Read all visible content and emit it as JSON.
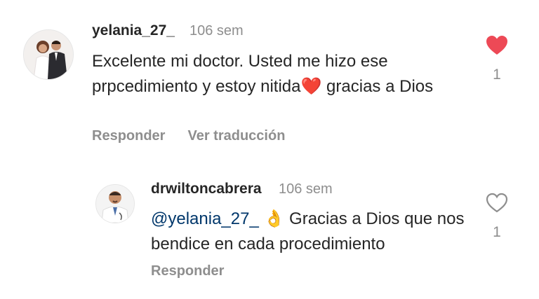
{
  "comments": [
    {
      "username": "yelania_27_",
      "time": "106 sem",
      "text_before": "Excelente mi doctor. Usted me hizo ese prpcedimiento y estoy nitida",
      "emoji": "❤️",
      "text_after": " gracias a Dios",
      "reply_label": "Responder",
      "translate_label": "Ver traducción",
      "likes": "1",
      "liked": true,
      "avatar": "couple-wedding-avatar"
    },
    {
      "username": "drwiltoncabrera",
      "time": "106 sem",
      "mention": "@yelania_27_",
      "emoji": "👌",
      "text": "Gracias a Dios que nos bendice en cada procedimiento",
      "reply_label": "Responder",
      "likes": "1",
      "liked": false,
      "avatar": "doctor-avatar"
    }
  ],
  "colors": {
    "heart_filled": "#ed4956",
    "muted": "#8e8e8e",
    "mention": "#00376b",
    "text": "#262626"
  }
}
